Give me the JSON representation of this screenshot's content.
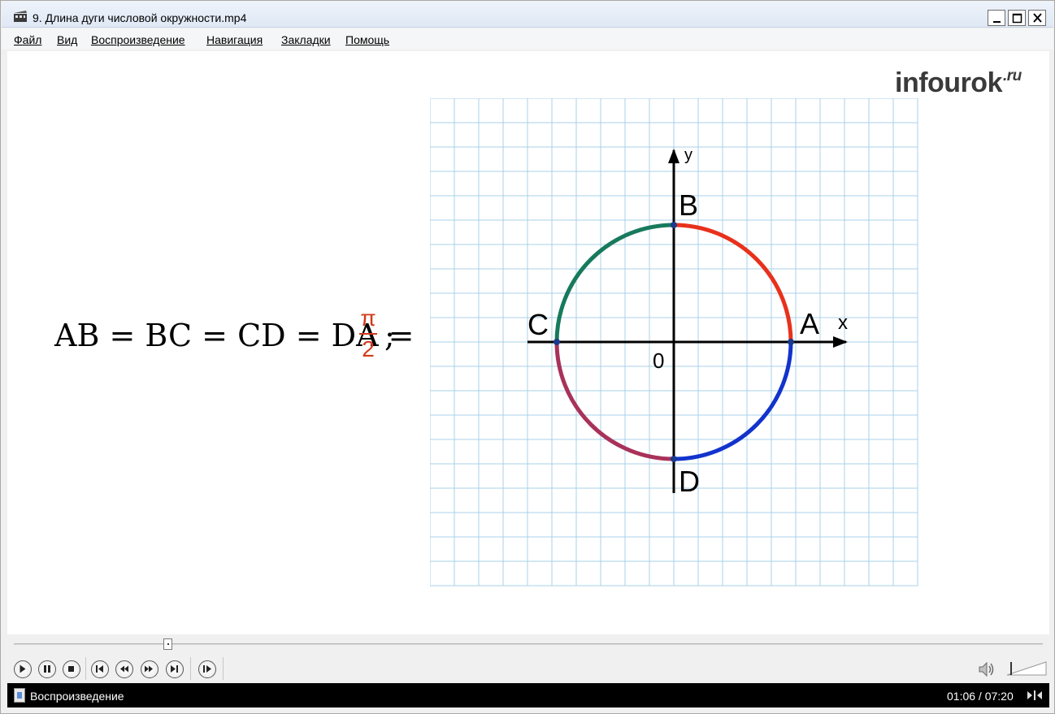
{
  "window": {
    "title": "9. Длина дуги числовой окружности.mp4",
    "min_symbol": "_",
    "max_symbol": "□",
    "close_symbol": "✕"
  },
  "menu": {
    "items": [
      "Файл",
      "Вид",
      "Воспроизведение",
      "Навигация",
      "Закладки",
      "Помощь"
    ]
  },
  "video": {
    "logo_text": "infourok",
    "logo_suffix": ".ru",
    "formula": {
      "equation": "AB = BC = CD = DA =",
      "numerator": "π",
      "denominator": "2",
      "terminator": ";"
    },
    "diagram": {
      "x_label": "x",
      "y_label": "y",
      "origin_label": "0",
      "points": {
        "A": "A",
        "B": "B",
        "C": "C",
        "D": "D"
      },
      "arc_colors": {
        "AB": "#e8311c",
        "BC": "#177a5c",
        "CD": "#a8325a",
        "DA": "#1233cc"
      },
      "grid_color": "#a9d0e8"
    }
  },
  "player": {
    "seek_progress": 0.15,
    "buttons": [
      "play",
      "pause",
      "stop",
      "previous",
      "rewind",
      "fast-forward",
      "next",
      "step"
    ]
  },
  "status": {
    "state": "Воспроизведение",
    "time": "01:06 / 07:20"
  }
}
